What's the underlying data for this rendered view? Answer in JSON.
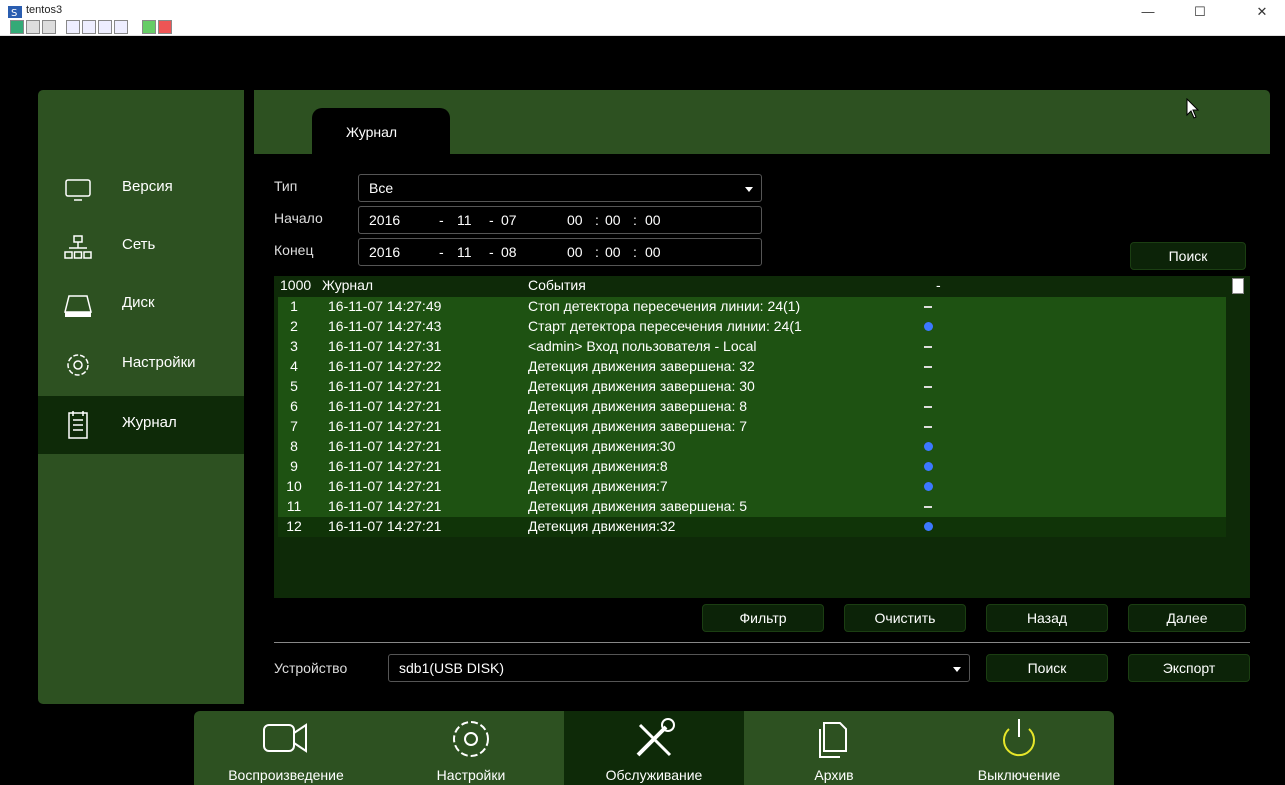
{
  "window": {
    "title": "tentos3",
    "minimize": "—",
    "maximize": "☐",
    "close": "✕"
  },
  "sidebar": {
    "items": [
      {
        "label": "Версия",
        "icon": "monitor-icon"
      },
      {
        "label": "Сеть",
        "icon": "network-icon"
      },
      {
        "label": "Диск",
        "icon": "disk-icon"
      },
      {
        "label": "Настройки",
        "icon": "gear-icon"
      },
      {
        "label": "Журнал",
        "icon": "log-icon",
        "active": true
      }
    ]
  },
  "tab": {
    "label": "Журнал"
  },
  "filters": {
    "type_label": "Тип",
    "type_value": "Все",
    "start_label": "Начало",
    "start": {
      "year": "2016",
      "month": "11",
      "day": "07",
      "hh": "00",
      "mm": "00",
      "ss": "00"
    },
    "end_label": "Конец",
    "end": {
      "year": "2016",
      "month": "11",
      "day": "08",
      "hh": "00",
      "mm": "00",
      "ss": "00"
    },
    "search_label": "Поиск"
  },
  "table": {
    "headers": {
      "count": "1000",
      "log": "Журнал",
      "events": "События",
      "extra": "-"
    },
    "rows": [
      {
        "num": "1",
        "time": "16-11-07 14:27:49",
        "event": "Стоп детектора пересечения линии: 24(1)",
        "mark": "dash"
      },
      {
        "num": "2",
        "time": "16-11-07 14:27:43",
        "event": "Старт детектора пересечения линии: 24(1",
        "mark": "play"
      },
      {
        "num": "3",
        "time": "16-11-07 14:27:31",
        "event": "<admin> Вход пользователя - Local",
        "mark": "dash"
      },
      {
        "num": "4",
        "time": "16-11-07 14:27:22",
        "event": "Детекция движения завершена: 32",
        "mark": "dash"
      },
      {
        "num": "5",
        "time": "16-11-07 14:27:21",
        "event": "Детекция движения завершена: 30",
        "mark": "dash"
      },
      {
        "num": "6",
        "time": "16-11-07 14:27:21",
        "event": "Детекция движения завершена: 8",
        "mark": "dash"
      },
      {
        "num": "7",
        "time": "16-11-07 14:27:21",
        "event": "Детекция движения завершена: 7",
        "mark": "dash"
      },
      {
        "num": "8",
        "time": "16-11-07 14:27:21",
        "event": "Детекция движения:30",
        "mark": "play"
      },
      {
        "num": "9",
        "time": "16-11-07 14:27:21",
        "event": "Детекция движения:8",
        "mark": "play"
      },
      {
        "num": "10",
        "time": "16-11-07 14:27:21",
        "event": "Детекция движения:7",
        "mark": "play"
      },
      {
        "num": "11",
        "time": "16-11-07 14:27:21",
        "event": "Детекция движения завершена: 5",
        "mark": "dash"
      },
      {
        "num": "12",
        "time": "16-11-07 14:27:21",
        "event": "Детекция движения:32",
        "mark": "play",
        "selected": true
      }
    ]
  },
  "actions": {
    "filter": "Фильтр",
    "clear": "Очистить",
    "back": "Назад",
    "next": "Далее"
  },
  "device": {
    "label": "Устройство",
    "value": "sdb1(USB DISK)",
    "search": "Поиск",
    "export": "Экспорт"
  },
  "bottombar": {
    "items": [
      {
        "label": "Воспроизведение",
        "icon": "camera-icon"
      },
      {
        "label": "Настройки",
        "icon": "gear-icon"
      },
      {
        "label": "Обслуживание",
        "icon": "tools-icon",
        "active": true
      },
      {
        "label": "Архив",
        "icon": "archive-icon"
      },
      {
        "label": "Выключение",
        "icon": "power-icon"
      }
    ]
  },
  "colors": {
    "panel_green": "#2d5121",
    "row_green": "#1e5212",
    "dark_green": "#0e2a08",
    "play_blue": "#3c78ff"
  }
}
